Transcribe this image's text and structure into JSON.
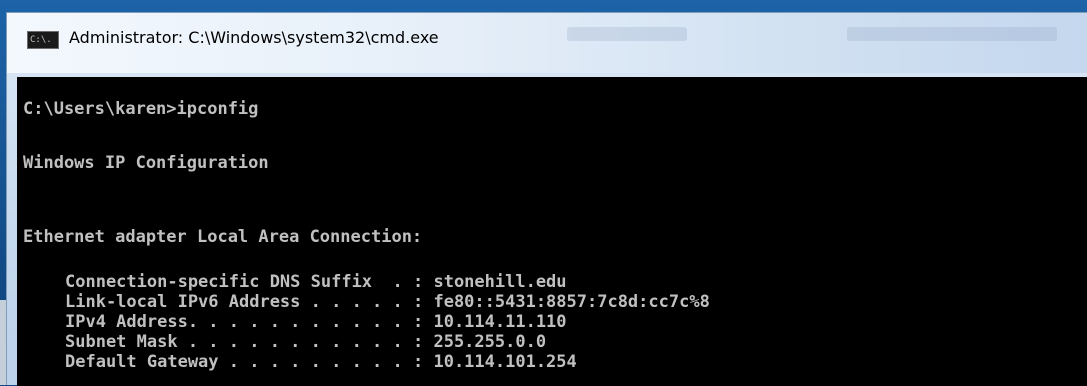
{
  "window": {
    "title": "Administrator: C:\\Windows\\system32\\cmd.exe",
    "icon": "cmd-icon",
    "icon_glyph": "C:\\."
  },
  "console": {
    "prompt_line": "C:\\Users\\karen>ipconfig",
    "header": "Windows IP Configuration",
    "adapter": "Ethernet adapter Local Area Connection:",
    "entries": [
      {
        "label": "Connection-specific DNS Suffix  . : ",
        "value": "stonehill.edu"
      },
      {
        "label": "Link-local IPv6 Address . . . . . : ",
        "value": "fe80::5431:8857:7c8d:cc7c%8"
      },
      {
        "label": "IPv4 Address. . . . . . . . . . . : ",
        "value": "10.114.11.110"
      },
      {
        "label": "Subnet Mask . . . . . . . . . . . : ",
        "value": "255.255.0.0"
      },
      {
        "label": "Default Gateway . . . . . . . . . : ",
        "value": "10.114.101.254"
      }
    ]
  },
  "colors": {
    "console_background": "#000000",
    "console_text": "#c0c0c0",
    "desktop_blue": "#0f4a82"
  }
}
